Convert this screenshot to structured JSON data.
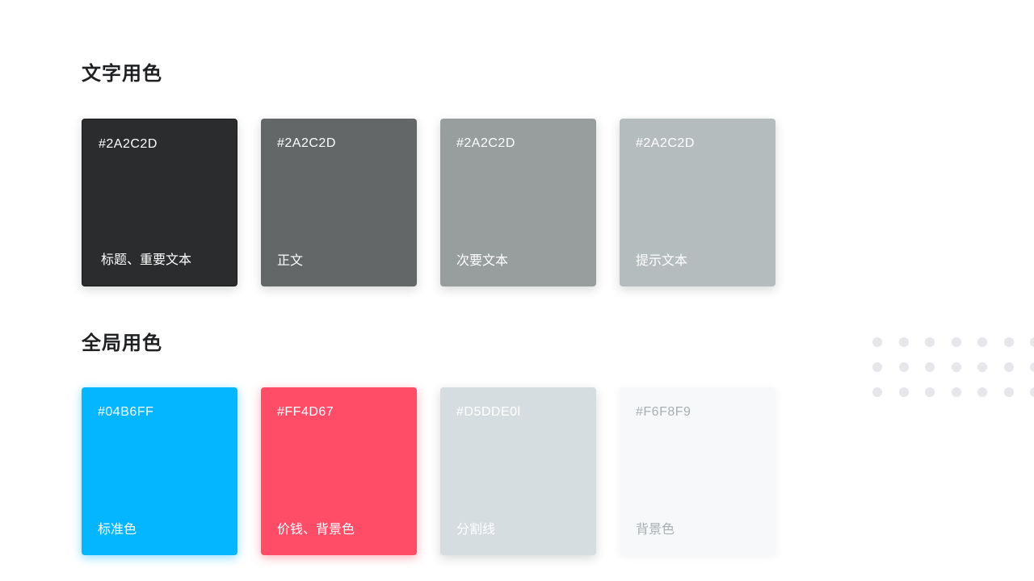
{
  "text_section": {
    "title": "文字用色",
    "swatches": [
      {
        "hex": "#2A2C2D",
        "label": "标题、重要文本",
        "color": "#2a2c2d",
        "text_color": "#ffffff"
      },
      {
        "hex": "#2A2C2D",
        "label": "正文",
        "color": "#636767",
        "text_color": "#ffffff"
      },
      {
        "hex": "#2A2C2D",
        "label": "次要文本",
        "color": "#989e9d",
        "text_color": "#ffffff"
      },
      {
        "hex": "#2A2C2D",
        "label": "提示文本",
        "color": "#b5bcbd",
        "text_color": "#ffffff"
      }
    ]
  },
  "global_section": {
    "title": "全局用色",
    "swatches": [
      {
        "hex": "#04B6FF",
        "label": "标准色",
        "color": "#04b6ff",
        "text_color": "#ffffff"
      },
      {
        "hex": "#FF4D67",
        "label": "价钱、背景色",
        "color": "#ff4d67",
        "text_color": "#ffffff"
      },
      {
        "hex": "#D5DDE0l",
        "label": "分割线",
        "color": "#d5dde0",
        "text_color": "#ffffff"
      },
      {
        "hex": "#F6F8F9",
        "label": "背景色",
        "color": "#f6f8f9",
        "text_color": "#a9aeb1"
      }
    ]
  }
}
